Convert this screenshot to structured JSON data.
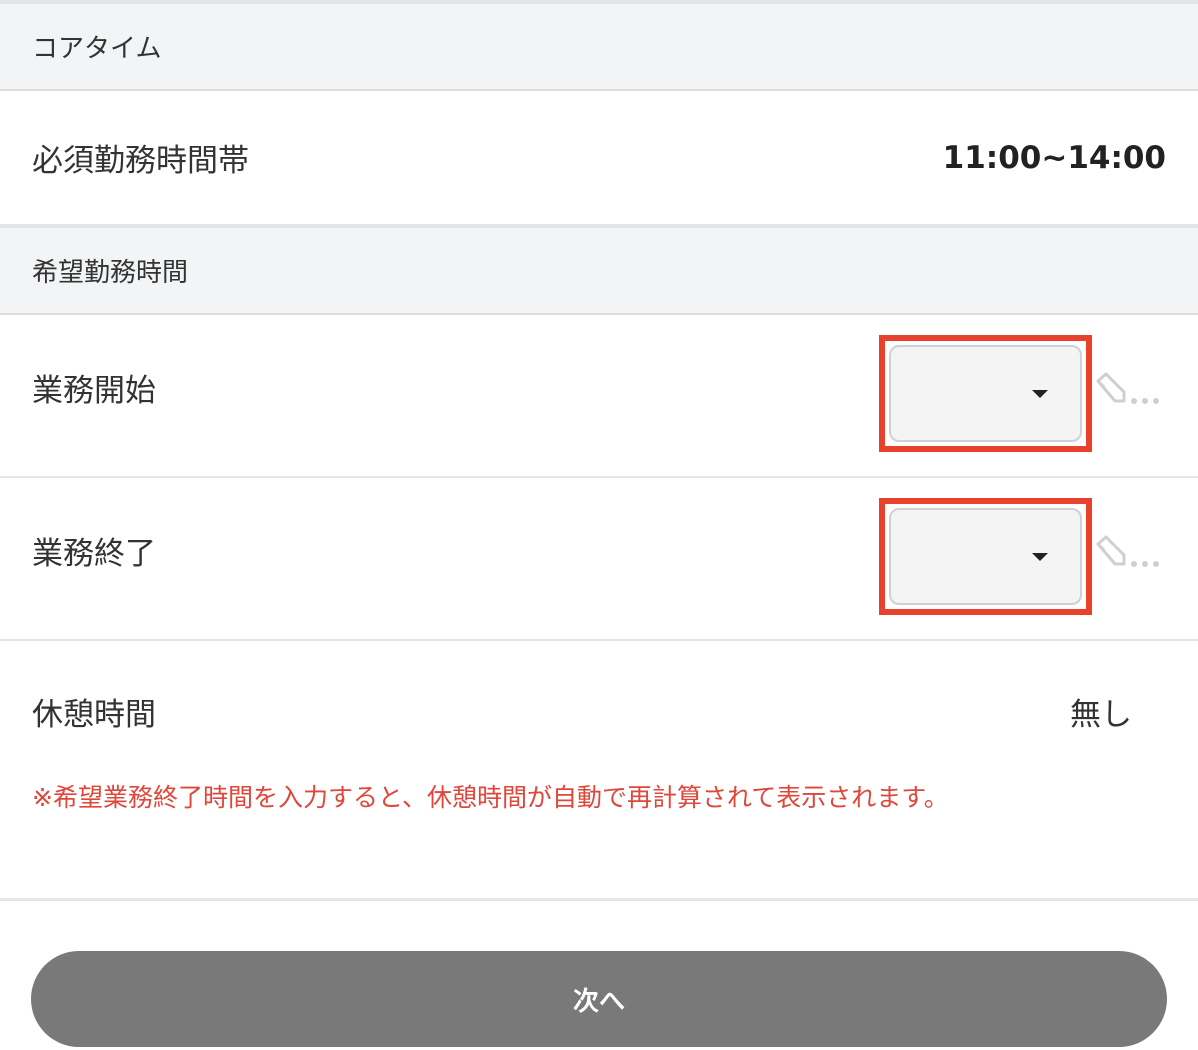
{
  "core_section": {
    "header": "コアタイム",
    "required_label": "必須勤務時間帯",
    "required_value": "11:00~14:00"
  },
  "desired_section": {
    "header": "希望勤務時間",
    "start": {
      "label": "業務開始",
      "selected": ""
    },
    "end": {
      "label": "業務終了",
      "selected": ""
    },
    "break": {
      "label": "休憩時間",
      "value": "無し"
    },
    "note": "※希望業務終了時間を入力すると、休憩時間が自動で再計算されて表示されます。"
  },
  "next_button": {
    "label": "次へ"
  },
  "icons": {
    "select_caret": "caret-down-icon",
    "edit": "pencil-icon"
  },
  "colors": {
    "highlight": "#e8412c",
    "note_text": "#e0463a",
    "button": "#797979",
    "header_bg": "#f3f4f6"
  }
}
